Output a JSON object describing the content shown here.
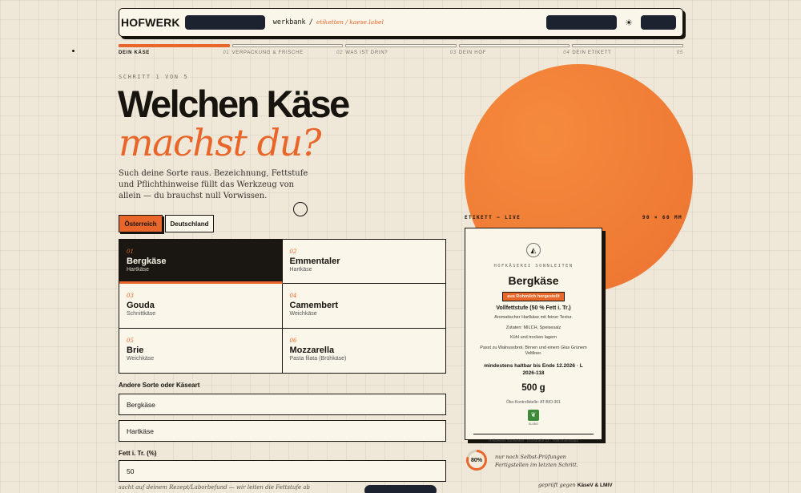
{
  "header": {
    "logo": "HOFWERK",
    "crumb_root": "werkbank",
    "crumb_sep": "/",
    "crumb_path": "etiketten / kaese.label",
    "theme_icon": "☀",
    "theme_icon_name": "sun-icon"
  },
  "steps": [
    {
      "label": "Dein Käse",
      "num": ""
    },
    {
      "label": "Verpackung & Frische",
      "num": "01"
    },
    {
      "label": "Was ist drin?",
      "num": "02"
    },
    {
      "label": "Dein Hof",
      "num": "03"
    },
    {
      "label": "Dein Etikett",
      "num": "04"
    }
  ],
  "steps_last_num": "05",
  "page": {
    "step_line": "SCHRITT 1 VON 5",
    "title_line1": "Welchen Käse",
    "title_line2": "machst du?",
    "intro": "Such deine Sorte raus. Bezeichnung, Fettstufe und Pflichthinweise füllt das Werkzeug von allein — du brauchst null Vorwissen."
  },
  "country": {
    "selected": "Österreich",
    "other": "Deutschland"
  },
  "cheeses": [
    {
      "n": "01",
      "name": "Bergkäse",
      "type": "Hartkäse"
    },
    {
      "n": "02",
      "name": "Emmentaler",
      "type": "Hartkäse"
    },
    {
      "n": "03",
      "name": "Gouda",
      "type": "Schnittkäse"
    },
    {
      "n": "04",
      "name": "Camembert",
      "type": "Weichkäse"
    },
    {
      "n": "05",
      "name": "Brie",
      "type": "Weichkäse"
    },
    {
      "n": "06",
      "name": "Mozzarella",
      "type": "Pasta filata (Brühkäse)"
    }
  ],
  "form": {
    "other_label": "Andere Sorte oder Käseart",
    "sort_value": "Bergkäse",
    "kind_value": "Hartkäse",
    "fat_label": "Fett i. Tr. (%)",
    "fat_value": "50",
    "hint": "sacht auf deinem Rezept/Laborbefund — wir leiten die Fettstufe ab"
  },
  "label_preview": {
    "head_left": "ETIKETT — LIVE",
    "head_right": "90 × 60 MM",
    "farm": "HOFKÄSEREI SONNLEITEN",
    "name": "Bergkäse",
    "milk_badge": "aus Rohmilch hergestellt",
    "fat": "Vollfettstufe (50 % Fett i. Tr.)",
    "desc": "Aromatischer Hartkäse mit feiner Textur.",
    "ingredients": "Zutaten: MILCH, Speisesalz",
    "storage": "Kühl und trocken lagern",
    "pairing": "Passt zu Walnussbrot, Birnen und einem Glas Grünem Veltliner.",
    "mhd": "mindestens haltbar bis Ende 12.2026 · L 2026-118",
    "weight": "500 g",
    "control": "Öko-Kontrollstelle: AT-BIO-301",
    "eu_code": "EU-BIO",
    "footer": "Hofkäserei Sonnleiten · Dorfstraße 12 · 7000 Eisenstadt"
  },
  "checks": {
    "percent": "80%",
    "progress": 0.8,
    "text1": "nur noch Selbst-Prüfungen",
    "text2": "Fertigstellen im letzten Schritt.",
    "verified_prefix": "geprüft gegen",
    "verified_ref": "KäseV & LMIV"
  },
  "colors": {
    "accent": "#e8662a",
    "dark": "#17140f",
    "paper": "#fbf6ea"
  }
}
